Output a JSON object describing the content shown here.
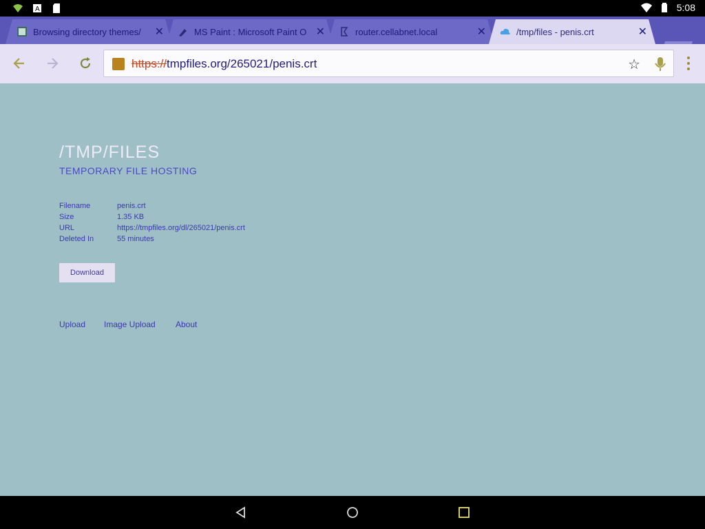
{
  "status_bar": {
    "time": "5:08"
  },
  "tabs": [
    {
      "title": "Browsing directory themes/",
      "active": false
    },
    {
      "title": "MS Paint : Microsoft Paint O",
      "active": false
    },
    {
      "title": "router.cellabnet.local",
      "active": false
    },
    {
      "title": "/tmp/files - penis.crt",
      "active": true
    }
  ],
  "toolbar": {
    "url_scheme": "https://",
    "url_rest": "tmpfiles.org/265021/penis.crt"
  },
  "page": {
    "title": "/TMP/FILES",
    "subtitle": "TEMPORARY FILE HOSTING",
    "info": [
      {
        "key": "Filename",
        "value": "penis.crt"
      },
      {
        "key": "Size",
        "value": "1.35 KB"
      },
      {
        "key": "URL",
        "value": "https://tmpfiles.org/dl/265021/penis.crt"
      },
      {
        "key": "Deleted In",
        "value": "55 minutes"
      }
    ],
    "download_label": "Download",
    "footer_links": [
      "Upload",
      "Image Upload",
      "About"
    ]
  },
  "colors": {
    "tab_strip": "#5a56b8",
    "toolbar": "#e6e1f4",
    "page_background": "#9fbfc6",
    "link": "#3a38b0"
  }
}
